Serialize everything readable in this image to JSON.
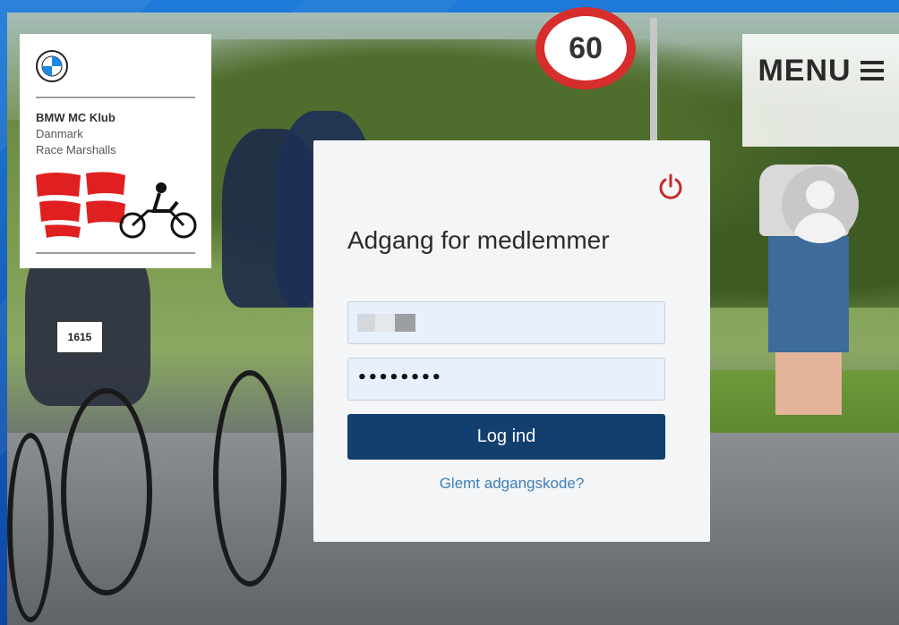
{
  "header": {
    "menu_label": "MENU"
  },
  "logo": {
    "club_name": "BMW MC Klub",
    "line2": "Danmark",
    "line3": "Race Marshalls"
  },
  "background": {
    "speed_sign": "60",
    "bib_number": "1615"
  },
  "login": {
    "title": "Adgang for medlemmer",
    "password_mask": "••••••••",
    "submit_label": "Log ind",
    "forgot_label": "Glemt adgangskode?"
  },
  "colors": {
    "primary_button": "#123f6e",
    "link": "#3d7fb7",
    "power_icon": "#c62828",
    "frame": "#1565c0"
  }
}
